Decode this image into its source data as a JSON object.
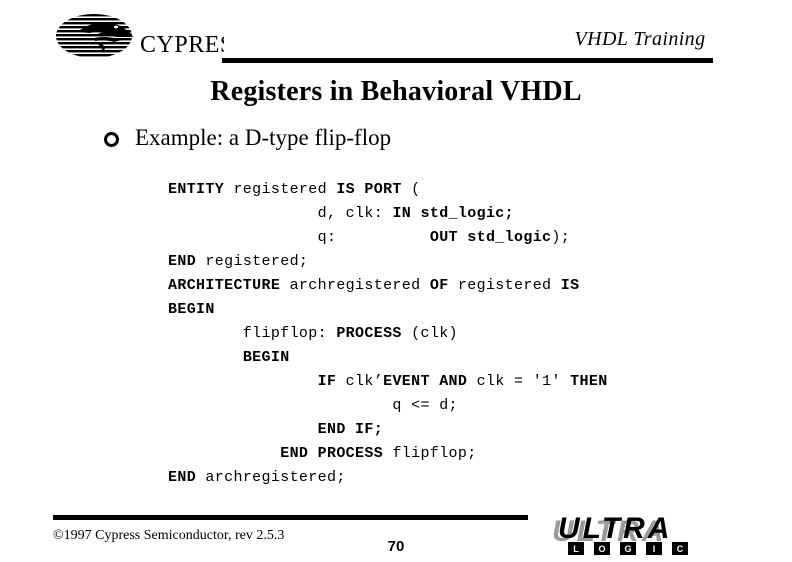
{
  "header": {
    "company_logo_text": "CYPRESS",
    "course_title": "VHDL Training"
  },
  "slide": {
    "title": "Registers in Behavioral VHDL",
    "bullet": {
      "marker": "hollow-circle-bullet",
      "text": "Example: a D-type flip-flop"
    }
  },
  "code": {
    "language": "VHDL",
    "lines": [
      [
        {
          "t": "ENTITY",
          "b": true
        },
        {
          "t": " registered ",
          "b": false
        },
        {
          "t": "IS PORT",
          "b": true
        },
        {
          "t": " (",
          "b": false
        }
      ],
      [
        {
          "t": "                d, clk: ",
          "b": false
        },
        {
          "t": "IN std_logic;",
          "b": true
        }
      ],
      [
        {
          "t": "                q:          ",
          "b": false
        },
        {
          "t": "OUT std_logic",
          "b": true
        },
        {
          "t": ");",
          "b": false
        }
      ],
      [
        {
          "t": "END",
          "b": true
        },
        {
          "t": " registered;",
          "b": false
        }
      ],
      [
        {
          "t": "ARCHITECTURE",
          "b": true
        },
        {
          "t": " archregistered ",
          "b": false
        },
        {
          "t": "OF",
          "b": true
        },
        {
          "t": " registered ",
          "b": false
        },
        {
          "t": "IS",
          "b": true
        }
      ],
      [
        {
          "t": "BEGIN",
          "b": true
        }
      ],
      [
        {
          "t": "        flipflop: ",
          "b": false
        },
        {
          "t": "PROCESS",
          "b": true
        },
        {
          "t": " (clk)",
          "b": false
        }
      ],
      [
        {
          "t": "        ",
          "b": false
        },
        {
          "t": "BEGIN",
          "b": true
        }
      ],
      [
        {
          "t": "                ",
          "b": false
        },
        {
          "t": "IF",
          "b": true
        },
        {
          "t": " clk’",
          "b": false
        },
        {
          "t": "EVENT AND",
          "b": true
        },
        {
          "t": " clk = '1' ",
          "b": false
        },
        {
          "t": "THEN",
          "b": true
        }
      ],
      [
        {
          "t": "                        q <= d;",
          "b": false
        }
      ],
      [
        {
          "t": "                ",
          "b": false
        },
        {
          "t": "END IF;",
          "b": true
        }
      ],
      [
        {
          "t": "            ",
          "b": false
        },
        {
          "t": "END PROCESS",
          "b": true
        },
        {
          "t": " flipflop;",
          "b": false
        }
      ],
      [
        {
          "t": "END",
          "b": true
        },
        {
          "t": " archregistered;",
          "b": false
        }
      ]
    ]
  },
  "footer": {
    "copyright": "©1997 Cypress Semiconductor, rev 2.5.3",
    "page_number": "70",
    "brand_logo": {
      "primary": "ULTRA",
      "secondary_letters": [
        "L",
        "O",
        "G",
        "I",
        "C"
      ]
    }
  },
  "colors": {
    "background": "#ffffff",
    "text": "#000000",
    "rule": "#000000",
    "logo_shadow": "#9a9a9a"
  }
}
